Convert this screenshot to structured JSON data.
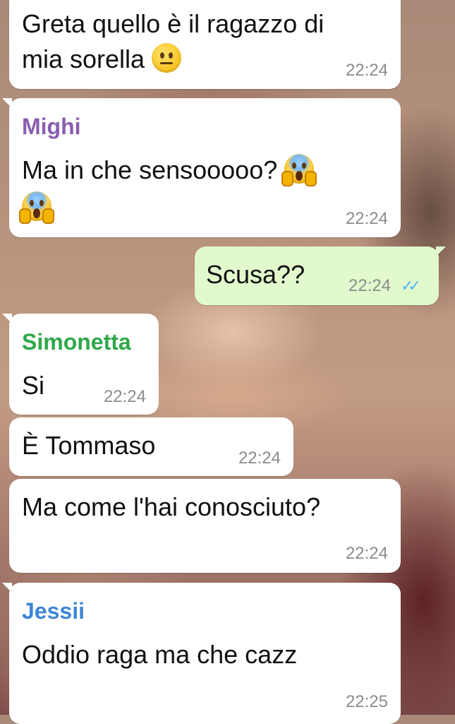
{
  "chat": {
    "messages": [
      {
        "type": "incoming",
        "text_line1": "Greta quello è il ragazzo di",
        "text_line2": "mia sorella",
        "emoji": "neutral-face-emoji",
        "time": "22:24"
      },
      {
        "type": "incoming",
        "sender": "Mighi",
        "sender_color": "#8b5eb0",
        "text_line1": "Ma in che sensooooo?",
        "emoji": "face-screaming-in-fear-emoji",
        "time": "22:24"
      },
      {
        "type": "outgoing",
        "text": "Scusa??",
        "time": "22:24",
        "status": "read-double-check-icon"
      },
      {
        "type": "incoming",
        "sender": "Simonetta",
        "sender_color": "#2ea84a",
        "text": "Si",
        "time": "22:24"
      },
      {
        "type": "incoming",
        "text": "È Tommaso",
        "time": "22:24"
      },
      {
        "type": "incoming",
        "text": "Ma come l'hai conosciuto?",
        "time": "22:24"
      },
      {
        "type": "incoming",
        "sender": "Jessii",
        "sender_color": "#3d86d6",
        "text": "Oddio raga ma che cazz",
        "time": "22:25"
      }
    ]
  },
  "colors": {
    "incoming_bubble": "#ffffff",
    "outgoing_bubble": "#e2f9cd",
    "timestamp": "#8c8c8c",
    "read_ticks": "#4fb6ec"
  }
}
